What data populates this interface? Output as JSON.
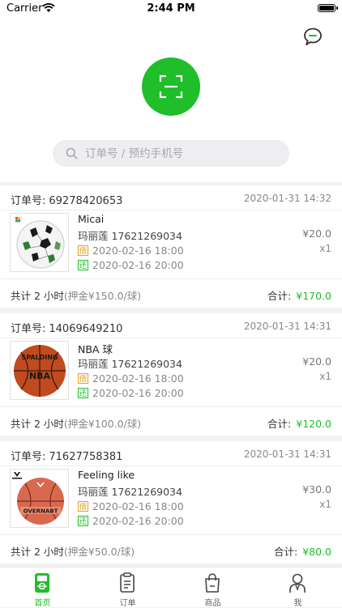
{
  "status_bar": {
    "carrier": "Carrier",
    "time": "2:44 PM"
  },
  "search": {
    "placeholder": "订单号 / 预约手机号"
  },
  "colors": {
    "accent": "#1fbe2a",
    "borrow_tag": "#e8a11c",
    "return_tag": "#1fbe2a"
  },
  "orders": [
    {
      "order_label": "订单号:",
      "order_no": "69278420653",
      "created_at": "2020-01-31 14:32",
      "product_name": "Micai",
      "customer": "玛丽莲 17621269034",
      "borrow_tag": "借",
      "borrow_time": "2020-02-16 18:00",
      "return_tag": "还",
      "return_time": "2020-02-16 20:00",
      "price": "¥20.0",
      "quantity": "x1",
      "summary_total": "共计 2 小时",
      "summary_deposit": "(押金¥150.0/球)",
      "total_label": "合计:",
      "total_value": "¥170.0",
      "image_icon": "soccer-ball"
    },
    {
      "order_label": "订单号:",
      "order_no": "14069649210",
      "created_at": "2020-01-31 14:31",
      "product_name": "NBA 球",
      "customer": "玛丽莲 17621269034",
      "borrow_tag": "借",
      "borrow_time": "2020-02-16 18:00",
      "return_tag": "还",
      "return_time": "2020-02-16 20:00",
      "price": "¥20.0",
      "quantity": "x1",
      "summary_total": "共计 2 小时",
      "summary_deposit": "(押金¥100.0/球)",
      "total_label": "合计:",
      "total_value": "¥120.0",
      "image_icon": "basketball",
      "image_brand": "SPALDING",
      "image_sub": "NBA"
    },
    {
      "order_label": "订单号:",
      "order_no": "71627758381",
      "created_at": "2020-01-31 14:31",
      "product_name": "Feeling like",
      "customer": "玛丽莲 17621269034",
      "borrow_tag": "借",
      "borrow_time": "2020-02-16 18:00",
      "return_tag": "还",
      "return_time": "2020-02-16 20:00",
      "price": "¥30.0",
      "quantity": "x1",
      "summary_total": "共计 2 小时",
      "summary_deposit": "(押金¥50.0/球)",
      "total_label": "合计:",
      "total_value": "¥80.0",
      "image_icon": "basketball",
      "image_brand": "OVERNABT"
    }
  ],
  "tabbar": {
    "items": [
      {
        "label": "首页",
        "icon": "home-icon",
        "active": true
      },
      {
        "label": "订单",
        "icon": "order-icon",
        "active": false
      },
      {
        "label": "商品",
        "icon": "bag-icon",
        "active": false
      },
      {
        "label": "我",
        "icon": "profile-icon",
        "active": false
      }
    ]
  }
}
